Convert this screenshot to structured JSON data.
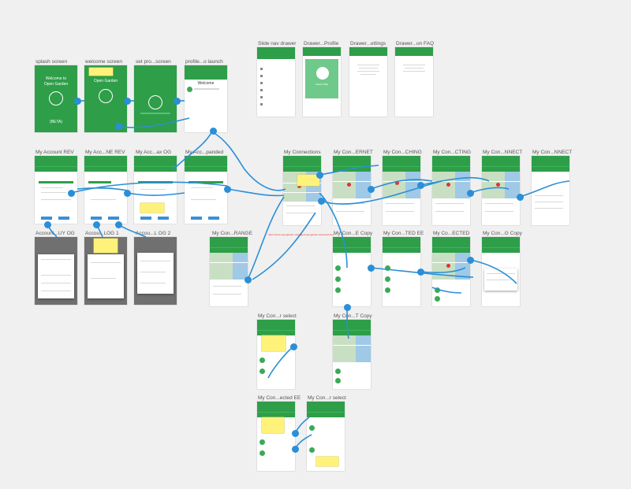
{
  "labels": {
    "splash": "splash screen",
    "welcome": "welcome screen",
    "setpro": "set pro...screen",
    "profile": "profile...o launch",
    "slidenav": "Slide nav drawer",
    "drawer_profile": "Drawer...Profile",
    "drawer_settings": "Drawer...ettings",
    "drawer_faq": "Drawer...on FAQ",
    "myacc_rev": "My Account REV",
    "myacc_ne_rev": "My Acc...NE REV",
    "myacc_ax_og": "My Acc...ax OG",
    "myacc_panded": "My Acc...panded",
    "acc_uy_og": "Account...UY OG",
    "acc_log1": "Accou...LOG 1",
    "acc_log2": "Accou...L OG 2",
    "myconn": "My Connections",
    "mycon_ernet": "My Con...ERNET",
    "mycon_ching": "My Con...CHING",
    "mycon_cting": "My Con...CTING",
    "mycon_nnect": "My Con...NNECT",
    "mycon_nnect2": "My Con...NNECT",
    "mycon_range": "My Con...RANGE",
    "mycon_ecopy": "My Con...E Copy",
    "mycon_tedee": "My Con...TED EE",
    "mycon_ected": "My Co...ECTED",
    "mycon_gcopy": "My Con...G Copy",
    "mycon_select1": "My Con...r select",
    "mycon_tcopy": "My Con...T Copy",
    "mycon_ectedee": "My Con...ected EE",
    "mycon_select2": "My Con...r select"
  },
  "splash": {
    "welcome": "Welcome to",
    "app": "Open Garden",
    "beta": "(BETA)"
  },
  "welcome_screen": {
    "app": "Open Garden"
  },
  "profile_screen": {
    "title": "Welcome"
  },
  "drawer_profile": {
    "name": "Sarah Philip"
  },
  "colors": {
    "brand_green": "#2e9e49",
    "link_blue": "#2a8fd6",
    "sticky_yellow": "#fff27a"
  },
  "icons": [
    "tree-logo-icon",
    "map-pin-icon",
    "avatar-icon",
    "menu-icon"
  ]
}
